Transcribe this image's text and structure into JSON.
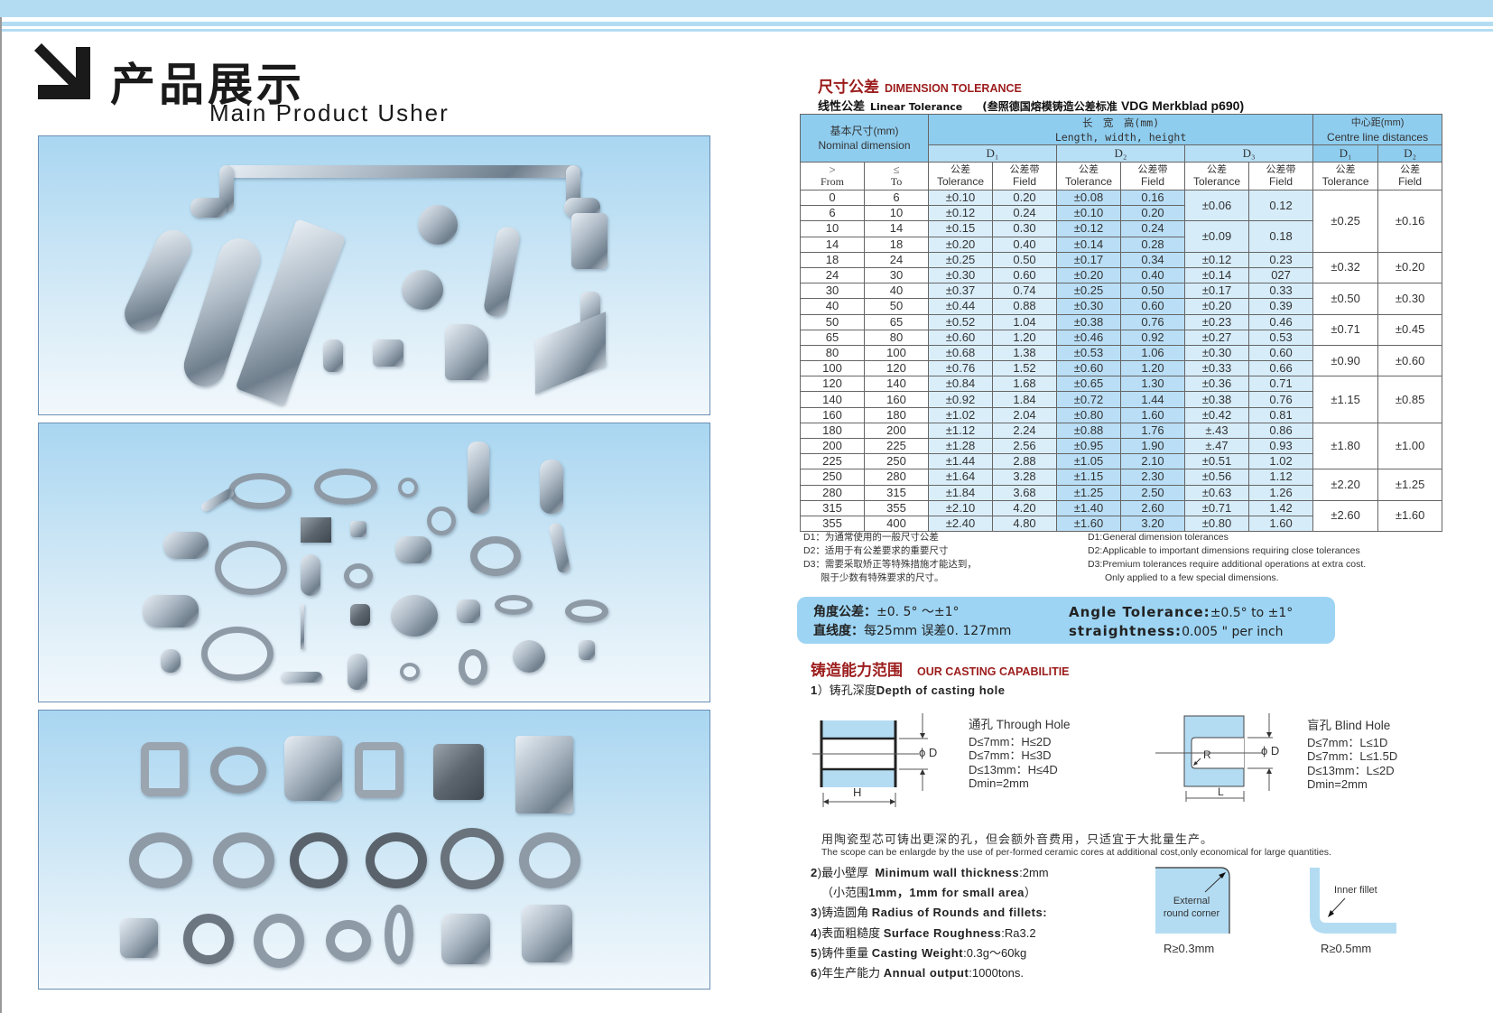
{
  "header": {
    "title_cn": "产品展示",
    "title_en": "Main Product Usher"
  },
  "photos": [
    {
      "label": "hardware-handles-panel",
      "description": "Polished metal handles, escutcheon plates and fittings"
    },
    {
      "label": "jewelry-figurines-panel",
      "description": "Cast jewelry, bangles, pendants and figurines"
    },
    {
      "label": "watch-cases-panel",
      "description": "Cast watch cases and bezels"
    }
  ],
  "dimension_tolerance": {
    "title_cn": "尺寸公差",
    "title_en": "DIMENSION TOLERANCE",
    "subtitle_cn": "线性公差",
    "subtitle_en": "Linear Tolerance",
    "reference_cn": "(叁照德国熔模铸造公差标准",
    "reference_en": "VDG Merkblad p690)",
    "headers": {
      "nominal_cn": "基本尺寸(mm)",
      "nominal_en": "Nominal dimension",
      "lwh_cn": "长　宽　高(mm)",
      "lwh_en": "Length,  width,  height",
      "centre_cn": "中心距(mm)",
      "centre_en": "Centre line distances",
      "d1": "D₁",
      "d2": "D₂",
      "d3": "D₃",
      "from_sym": ">",
      "from": "From",
      "to_sym": "≤",
      "to": "To",
      "tol_cn": "公差",
      "tol_en": "Tolerance",
      "field_cn": "公差带",
      "field_en": "Field",
      "c_tol_cn": "公差",
      "c_tol_en": "Tolerance",
      "c_field_cn": "公差",
      "c_field_en": "Field"
    },
    "rows": [
      {
        "from": "0",
        "to": "6",
        "d1_tol": "±0.10",
        "d1_field": "0.20",
        "d2_tol": "±0.08",
        "d2_field": "0.16"
      },
      {
        "from": "6",
        "to": "10",
        "d1_tol": "±0.12",
        "d1_field": "0.24",
        "d2_tol": "±0.10",
        "d2_field": "0.20"
      },
      {
        "from": "10",
        "to": "14",
        "d1_tol": "±0.15",
        "d1_field": "0.30",
        "d2_tol": "±0.12",
        "d2_field": "0.24"
      },
      {
        "from": "14",
        "to": "18",
        "d1_tol": "±0.20",
        "d1_field": "0.40",
        "d2_tol": "±0.14",
        "d2_field": "0.28"
      },
      {
        "from": "18",
        "to": "24",
        "d1_tol": "±0.25",
        "d1_field": "0.50",
        "d2_tol": "±0.17",
        "d2_field": "0.34",
        "d3_tol": "±0.12",
        "d3_field": "0.23"
      },
      {
        "from": "24",
        "to": "30",
        "d1_tol": "±0.30",
        "d1_field": "0.60",
        "d2_tol": "±0.20",
        "d2_field": "0.40",
        "d3_tol": "±0.14",
        "d3_field": "027"
      },
      {
        "from": "30",
        "to": "40",
        "d1_tol": "±0.37",
        "d1_field": "0.74",
        "d2_tol": "±0.25",
        "d2_field": "0.50",
        "d3_tol": "±0.17",
        "d3_field": "0.33"
      },
      {
        "from": "40",
        "to": "50",
        "d1_tol": "±0.44",
        "d1_field": "0.88",
        "d2_tol": "±0.30",
        "d2_field": "0.60",
        "d3_tol": "±0.20",
        "d3_field": "0.39"
      },
      {
        "from": "50",
        "to": "65",
        "d1_tol": "±0.52",
        "d1_field": "1.04",
        "d2_tol": "±0.38",
        "d2_field": "0.76",
        "d3_tol": "±0.23",
        "d3_field": "0.46"
      },
      {
        "from": "65",
        "to": "80",
        "d1_tol": "±0.60",
        "d1_field": "1.20",
        "d2_tol": "±0.46",
        "d2_field": "0.92",
        "d3_tol": "±0.27",
        "d3_field": "0.53"
      },
      {
        "from": "80",
        "to": "100",
        "d1_tol": "±0.68",
        "d1_field": "1.38",
        "d2_tol": "±0.53",
        "d2_field": "1.06",
        "d3_tol": "±0.30",
        "d3_field": "0.60"
      },
      {
        "from": "100",
        "to": "120",
        "d1_tol": "±0.76",
        "d1_field": "1.52",
        "d2_tol": "±0.60",
        "d2_field": "1.20",
        "d3_tol": "±0.33",
        "d3_field": "0.66"
      },
      {
        "from": "120",
        "to": "140",
        "d1_tol": "±0.84",
        "d1_field": "1.68",
        "d2_tol": "±0.65",
        "d2_field": "1.30",
        "d3_tol": "±0.36",
        "d3_field": "0.71"
      },
      {
        "from": "140",
        "to": "160",
        "d1_tol": "±0.92",
        "d1_field": "1.84",
        "d2_tol": "±0.72",
        "d2_field": "1.44",
        "d3_tol": "±0.38",
        "d3_field": "0.76"
      },
      {
        "from": "160",
        "to": "180",
        "d1_tol": "±1.02",
        "d1_field": "2.04",
        "d2_tol": "±0.80",
        "d2_field": "1.60",
        "d3_tol": "±0.42",
        "d3_field": "0.81"
      },
      {
        "from": "180",
        "to": "200",
        "d1_tol": "±1.12",
        "d1_field": "2.24",
        "d2_tol": "±0.88",
        "d2_field": "1.76",
        "d3_tol": "±.43",
        "d3_field": "0.86"
      },
      {
        "from": "200",
        "to": "225",
        "d1_tol": "±1.28",
        "d1_field": "2.56",
        "d2_tol": "±0.95",
        "d2_field": "1.90",
        "d3_tol": "±.47",
        "d3_field": "0.93"
      },
      {
        "from": "225",
        "to": "250",
        "d1_tol": "±1.44",
        "d1_field": "2.88",
        "d2_tol": "±1.05",
        "d2_field": "2.10",
        "d3_tol": "±0.51",
        "d3_field": "1.02"
      },
      {
        "from": "250",
        "to": "280",
        "d1_tol": "±1.64",
        "d1_field": "3.28",
        "d2_tol": "±1.15",
        "d2_field": "2.30",
        "d3_tol": "±0.56",
        "d3_field": "1.12"
      },
      {
        "from": "280",
        "to": "315",
        "d1_tol": "±1.84",
        "d1_field": "3.68",
        "d2_tol": "±1.25",
        "d2_field": "2.50",
        "d3_tol": "±0.63",
        "d3_field": "1.26"
      },
      {
        "from": "315",
        "to": "355",
        "d1_tol": "±2.10",
        "d1_field": "4.20",
        "d2_tol": "±1.40",
        "d2_field": "2.60",
        "d3_tol": "±0.71",
        "d3_field": "1.42"
      },
      {
        "from": "355",
        "to": "400",
        "d1_tol": "±2.40",
        "d1_field": "4.80",
        "d2_tol": "±1.60",
        "d2_field": "3.20",
        "d3_tol": "±0.80",
        "d3_field": "1.60"
      }
    ],
    "d3_merged": [
      {
        "rows": "0-10",
        "tol": "±0.06",
        "field": "0.12"
      },
      {
        "rows": "10-18",
        "tol": "±0.09",
        "field": "0.18"
      }
    ],
    "centre_groups": [
      {
        "rows": "0-18",
        "d1": "±0.25",
        "d2": "±0.16"
      },
      {
        "rows": "18-30",
        "d1": "±0.32",
        "d2": "±0.20"
      },
      {
        "rows": "30-50",
        "d1": "±0.50",
        "d2": "±0.30"
      },
      {
        "rows": "50-80",
        "d1": "±0.71",
        "d2": "±0.45"
      },
      {
        "rows": "80-120",
        "d1": "±0.90",
        "d2": "±0.60"
      },
      {
        "rows": "120-180",
        "d1": "±1.15",
        "d2": "±0.85"
      },
      {
        "rows": "180-250",
        "d1": "±1.80",
        "d2": "±1.00"
      },
      {
        "rows": "250-315",
        "d1": "±2.20",
        "d2": "±1.25"
      },
      {
        "rows": "315-400",
        "d1": "±2.60",
        "d2": "±1.60"
      }
    ],
    "notes_cn": [
      "D1：为通常使用的一般尺寸公差",
      "D2：适用于有公差要求的重要尺寸",
      "D3：需要采取矫正等特殊措施才能达到，",
      "限于少数有特殊要求的尺寸。"
    ],
    "notes_en": [
      "D1:General dimension tolerances",
      "D2:Applicable to important dimensions requiring close tolerances",
      "D3:Premium tolerances require additional operations at extra cost.",
      "Only applied to a few special dimensions."
    ]
  },
  "angle": {
    "angle_cn_label": "角度公差：",
    "angle_cn_value": "±0. 5°  ～±1°",
    "straight_cn_label": "直线度：",
    "straight_cn_value": "每25mm 误差0. 127mm",
    "angle_en_label": "Angle Tolerance:",
    "angle_en_value": "±0.5°  to  ±1°",
    "straight_en_label": "straightness:",
    "straight_en_value": "0.005 \" per inch"
  },
  "capability": {
    "title_cn": "铸造能力范围",
    "title_en": "OUR CASTING CAPABILITIE",
    "item1_num": "1",
    "item1_cn": "）铸孔深度",
    "item1_en": "Depth of casting hole",
    "through_hole": {
      "title": "通孔  Through Hole",
      "lines": [
        "D≤7mm：H≤2D",
        "D≤7mm：H≤3D",
        "D≤13mm：H≤4D",
        "Dmin=2mm"
      ],
      "label_d": "ϕ D",
      "label_h": "H"
    },
    "blind_hole": {
      "title": "盲孔  Blind Hole",
      "lines": [
        "D≤7mm：L≤1D",
        "D≤7mm：L≤1.5D",
        "D≤13mm：L≤2D",
        "Dmin=2mm"
      ],
      "label_d": "ϕ D",
      "label_r": "R",
      "label_l": "L"
    },
    "ceramic_cn": "用陶瓷型芯可铸出更深的孔，但会额外音费用，只适宜于大批量生产。",
    "ceramic_en": "The scope can be enlargde by the use of per-formed ceramic cores at additional cost,only economical for large quantities.",
    "item2_num": "2",
    "item2_cn": ")最小壁厚",
    "item2_en": "Minimum wall thickness",
    "item2_val": ":2mm",
    "item2b_cn": "（小范围",
    "item2b_en": "1mm，1mm for small area",
    "item2b_end": "）",
    "item3_num": "3",
    "item3_cn": ")铸造圆角",
    "item3_en": "Radius of Rounds and fillets:",
    "item4_num": "4",
    "item4_cn": ")表面粗糙度",
    "item4_en": "Surface Roughness",
    "item4_val": ":Ra3.2",
    "item5_num": "5",
    "item5_cn": ")铸件重量",
    "item5_en": "Casting Weight",
    "item5_val": ":0.3g～60kg",
    "item6_num": "6",
    "item6_cn": ")年生产能力",
    "item6_en": "Annual output",
    "item6_val": ":1000tons.",
    "external_label_1": "External",
    "external_label_2": "round corner",
    "external_value": "R≥0.3mm",
    "inner_label": "Inner fillet",
    "inner_value": "R≥0.5mm"
  },
  "colors": {
    "accent_blue": "#9dd4f3",
    "header_blue": "#8fcdef",
    "title_red": "#9c1c1c"
  }
}
